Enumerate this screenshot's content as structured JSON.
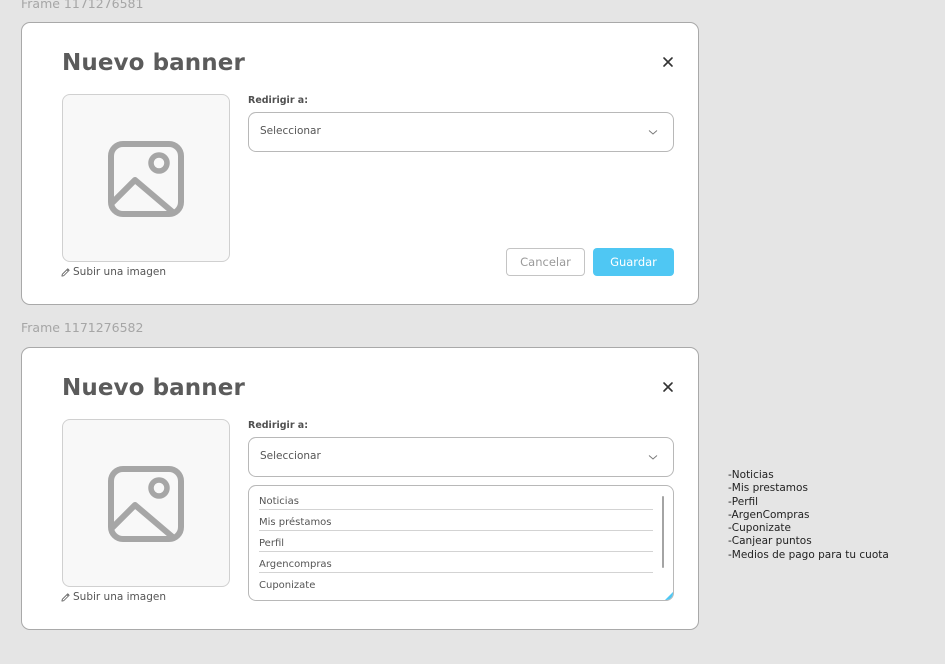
{
  "frames": [
    {
      "label": "Frame 1171276581",
      "title": "Nuevo banner",
      "upload_label": "Subir una imagen",
      "redirect_label": "Redirigir a:",
      "select_value": "Seleccionar",
      "cancel_label": "Cancelar",
      "save_label": "Guardar"
    },
    {
      "label": "Frame 1171276582",
      "title": "Nuevo banner",
      "upload_label": "Subir una imagen",
      "redirect_label": "Redirigir a:",
      "select_value": "Seleccionar",
      "dropdown_options": [
        "Noticias",
        "Mis préstamos",
        "Perfil",
        "Argencompras",
        "Cuponizate"
      ]
    }
  ],
  "notes": [
    "-Noticias",
    "-Mis prestamos",
    "-Perfil",
    "-ArgenCompras",
    "-Cuponizate",
    "-Canjear puntos",
    "-Medios de pago para tu cuota"
  ],
  "icons": {
    "image": "image-placeholder-icon",
    "close": "close-icon",
    "chevron": "chevron-down-icon",
    "pencil": "pencil-icon"
  },
  "colors": {
    "background": "#e5e5e5",
    "primary": "#4fc7f3",
    "title": "#5b5b5b",
    "icon": "#a6a6a6"
  }
}
